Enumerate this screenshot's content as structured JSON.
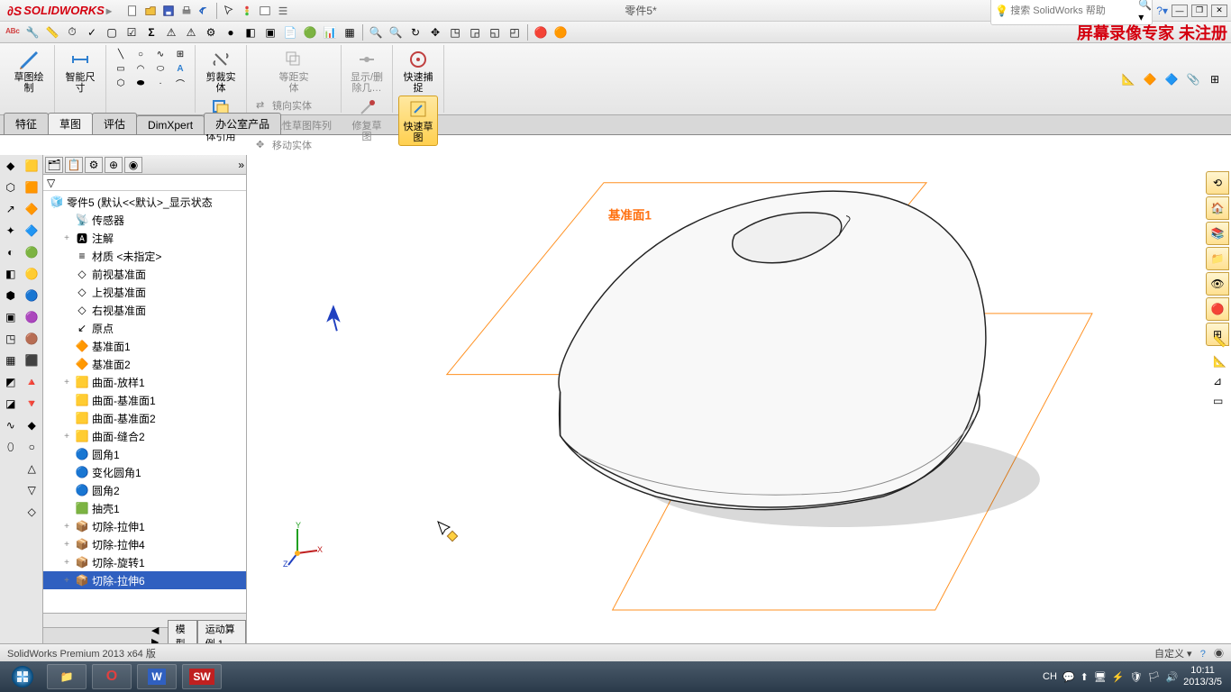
{
  "app": {
    "name": "SOLIDWORKS",
    "document_title": "零件5*"
  },
  "search": {
    "placeholder": "搜索 SolidWorks 帮助"
  },
  "watermark": "屏幕录像专家 未注册",
  "ribbon": {
    "sketch_draw": "草图绘制",
    "smart_dim": "智能尺寸",
    "trim": "剪裁实体",
    "convert": "转换实体引用",
    "offset": "等距实体",
    "mirror": "镜向实体",
    "linear_pattern": "线性草图阵列",
    "move": "移动实体",
    "show_del": "显示/删除几…",
    "repair": "修复草图",
    "quick_snap": "快速捕捉",
    "quick_sketch": "快速草图"
  },
  "cmd_tabs": [
    "特征",
    "草图",
    "评估",
    "DimXpert",
    "办公室产品"
  ],
  "cmd_tab_active": 1,
  "tree_root": "零件5 (默认<<默认>_显示状态",
  "tree": [
    {
      "l": "传感器",
      "exp": "",
      "ico": "sensor"
    },
    {
      "l": "注解",
      "exp": "+",
      "ico": "annot"
    },
    {
      "l": "材质 <未指定>",
      "exp": "",
      "ico": "mat"
    },
    {
      "l": "前视基准面",
      "exp": "",
      "ico": "plane"
    },
    {
      "l": "上视基准面",
      "exp": "",
      "ico": "plane"
    },
    {
      "l": "右视基准面",
      "exp": "",
      "ico": "plane"
    },
    {
      "l": "原点",
      "exp": "",
      "ico": "origin"
    },
    {
      "l": "基准面1",
      "exp": "",
      "ico": "planey"
    },
    {
      "l": "基准面2",
      "exp": "",
      "ico": "planey"
    },
    {
      "l": "曲面-放样1",
      "exp": "+",
      "ico": "surf"
    },
    {
      "l": "曲面-基准面1",
      "exp": "",
      "ico": "surf"
    },
    {
      "l": "曲面-基准面2",
      "exp": "",
      "ico": "surf"
    },
    {
      "l": "曲面-缝合2",
      "exp": "+",
      "ico": "surf"
    },
    {
      "l": "圆角1",
      "exp": "",
      "ico": "fillet"
    },
    {
      "l": "变化圆角1",
      "exp": "",
      "ico": "fillet"
    },
    {
      "l": "圆角2",
      "exp": "",
      "ico": "fillet"
    },
    {
      "l": "抽壳1",
      "exp": "",
      "ico": "shell"
    },
    {
      "l": "切除-拉伸1",
      "exp": "+",
      "ico": "cut"
    },
    {
      "l": "切除-拉伸4",
      "exp": "+",
      "ico": "cut"
    },
    {
      "l": "切除-旋转1",
      "exp": "+",
      "ico": "cut"
    },
    {
      "l": "切除-拉伸6",
      "exp": "+",
      "ico": "cut",
      "sel": true
    }
  ],
  "planes": {
    "p1": "基准面1",
    "p2": "基准面2"
  },
  "bottom_tabs": [
    "模型",
    "运动算例 1"
  ],
  "status": {
    "left": "SolidWorks Premium 2013 x64 版",
    "right": "自定义"
  },
  "taskbar": {
    "ime": "CH",
    "time": "10:11",
    "date": "2013/3/5"
  }
}
